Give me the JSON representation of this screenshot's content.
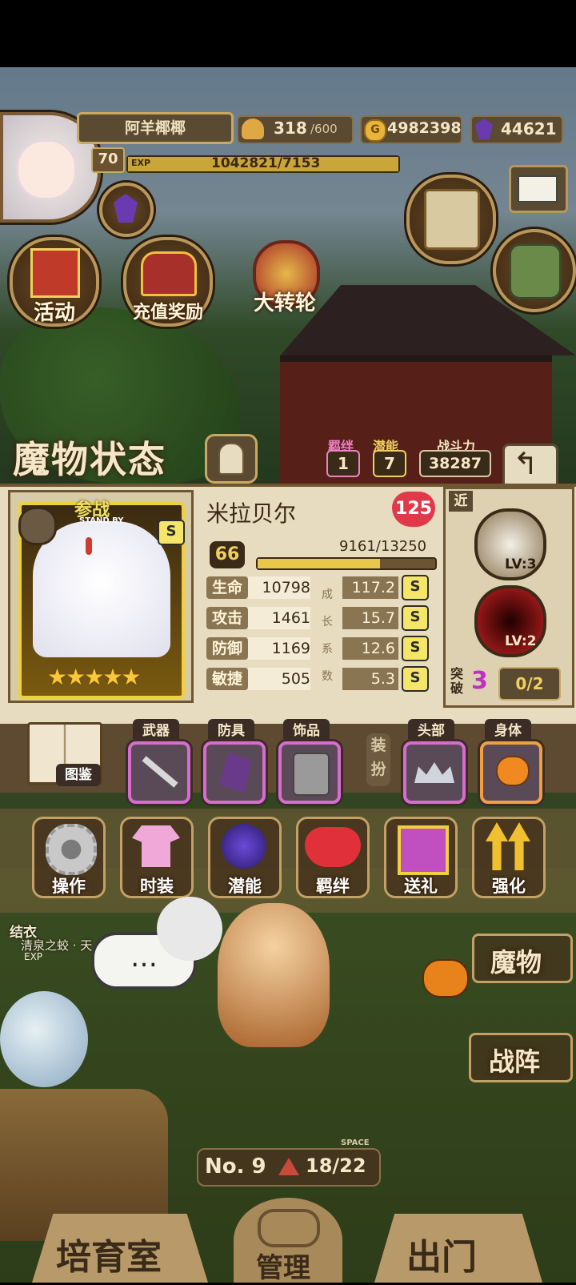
{
  "header": {
    "player_name": "阿羊椰椰",
    "level": "70",
    "exp_label": "EXP",
    "exp_text": "1042821/7153",
    "stamina": "318",
    "stamina_max": "/600",
    "gold": "4982398",
    "gems": "44621"
  },
  "top_buttons": {
    "activity": "活动",
    "recharge": "充值奖励",
    "wheel": "大转轮"
  },
  "status": {
    "title": "魔物状态",
    "bond_label": "羁绊",
    "bond_value": "1",
    "potential_label": "潜能",
    "potential_value": "7",
    "power_label": "战斗力",
    "power_value": "38287"
  },
  "monster": {
    "name": "米拉贝尔",
    "hearts": "125",
    "standby_label": "参战",
    "standby_sub": "STAND BY",
    "rank_badge": "S",
    "stars": 5,
    "level": "66",
    "exp_text": "9161/13250",
    "exp_fraction": 0.69,
    "growth_label": [
      "成",
      "长",
      "系",
      "数"
    ],
    "stats": [
      {
        "name": "生命",
        "value": "10798",
        "growth": "117.2",
        "grade": "S"
      },
      {
        "name": "攻击",
        "value": "1461",
        "growth": "15.7",
        "grade": "S"
      },
      {
        "name": "防御",
        "value": "1169",
        "growth": "12.6",
        "grade": "S"
      },
      {
        "name": "敏捷",
        "value": "505",
        "growth": "5.3",
        "grade": "S"
      }
    ],
    "range_tag": "近",
    "skill1_level": "LV:3",
    "skill2_level": "LV:2",
    "breakthrough_label": "突破",
    "breakthrough_value": "3",
    "breakthrough_progress": "0/2"
  },
  "equipment": {
    "guide_label": "图鉴",
    "weapon": "武器",
    "armor": "防具",
    "accessory": "饰品",
    "equip_label": "装扮",
    "head": "头部",
    "body": "身体"
  },
  "menu": [
    "操作",
    "时装",
    "潜能",
    "羁绊",
    "送礼",
    "强化"
  ],
  "scene": {
    "npc_name": "结衣",
    "npc_sub": "清泉之蛟 · 天",
    "npc_exp": "EXP",
    "chat_bubble": "…",
    "monster_button": "魔物",
    "formation_button": "战阵",
    "room_no": "No. 9",
    "space_label": "SPACE",
    "space_value": "18/22",
    "nursery": "培育室",
    "manage": "管理",
    "exit": "出门"
  }
}
